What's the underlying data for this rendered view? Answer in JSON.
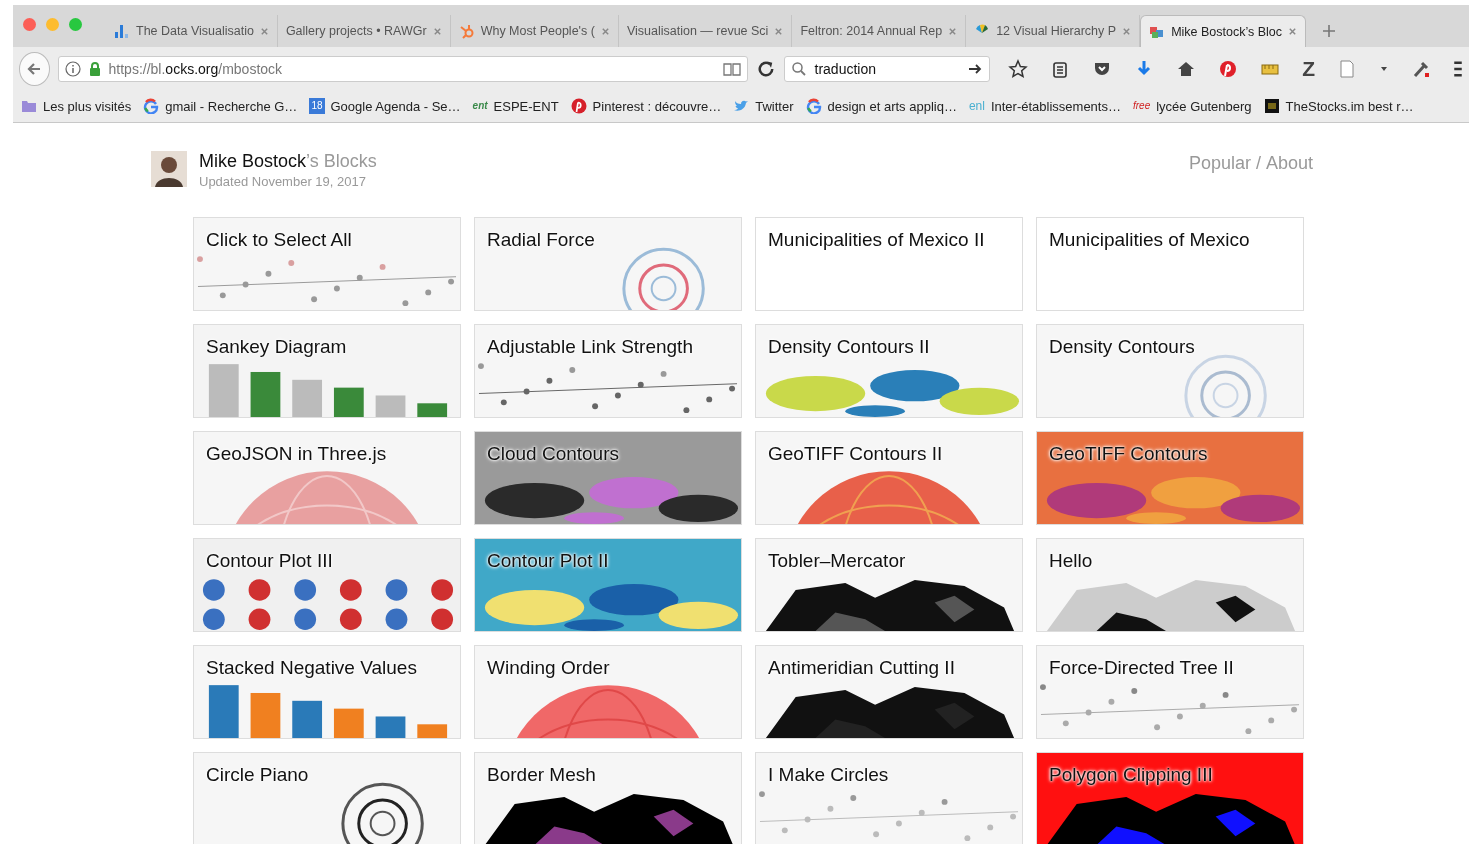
{
  "tabs": [
    {
      "title": "The Data Visualisatio",
      "kind": "bars",
      "selected": false
    },
    {
      "title": "Gallery projects • RAWGr",
      "kind": "none",
      "selected": false
    },
    {
      "title": "Why Most People's (",
      "kind": "hub",
      "selected": false
    },
    {
      "title": "Visualisation — revue Sci",
      "kind": "none",
      "selected": false
    },
    {
      "title": "Feltron: 2014 Annual Rep",
      "kind": "none",
      "selected": false
    },
    {
      "title": "12 Visual Hierarchy P",
      "kind": "fan",
      "selected": false
    },
    {
      "title": "Mike Bostock’s Bloc",
      "kind": "cubes",
      "selected": true
    }
  ],
  "url": {
    "scheme": "https://bl.",
    "domain": "ocks.org",
    "path": "/mbostock"
  },
  "search": {
    "value": "traduction"
  },
  "toolbar_text": "Z",
  "bookmarks": [
    {
      "label": "Les plus visités",
      "kind": "folder"
    },
    {
      "label": "gmail - Recherche G…",
      "kind": "google"
    },
    {
      "label": "Google Agenda - Se…",
      "kind": "calendar",
      "icon_text": "18"
    },
    {
      "label": "ESPE-ENT",
      "kind": "ent",
      "icon_text": "ent"
    },
    {
      "label": "Pinterest : découvre…",
      "kind": "pinterest"
    },
    {
      "label": "Twitter",
      "kind": "twitter"
    },
    {
      "label": "design et arts appliq…",
      "kind": "google"
    },
    {
      "label": "Inter-établissements…",
      "kind": "enl",
      "icon_text": "enl"
    },
    {
      "label": "lycée Gutenberg",
      "kind": "free",
      "icon_text": "free"
    },
    {
      "label": "TheStocks.im best r…",
      "kind": "stocks"
    }
  ],
  "header": {
    "owner": "Mike Bostock",
    "suffix": "’s Blocks",
    "updated": "Updated November 19, 2017",
    "nav": [
      "Popular",
      "/",
      "About"
    ]
  },
  "blocks": [
    {
      "title": "Click to Select All",
      "thumbnail": true
    },
    {
      "title": "Radial Force",
      "thumbnail": true
    },
    {
      "title": "Municipalities of Mexico II",
      "thumbnail": false
    },
    {
      "title": "Municipalities of Mexico",
      "thumbnail": false
    },
    {
      "title": "Sankey Diagram",
      "thumbnail": true
    },
    {
      "title": "Adjustable Link Strength",
      "thumbnail": true
    },
    {
      "title": "Density Contours II",
      "thumbnail": true
    },
    {
      "title": "Density Contours",
      "thumbnail": true
    },
    {
      "title": "GeoJSON in Three.js",
      "thumbnail": true
    },
    {
      "title": "Cloud Contours",
      "thumbnail": true
    },
    {
      "title": "GeoTIFF Contours II",
      "thumbnail": true
    },
    {
      "title": "GeoTIFF Contours",
      "thumbnail": true
    },
    {
      "title": "Contour Plot III",
      "thumbnail": true
    },
    {
      "title": "Contour Plot II",
      "thumbnail": true
    },
    {
      "title": "Tobler–Mercator",
      "thumbnail": true
    },
    {
      "title": "Hello",
      "thumbnail": true
    },
    {
      "title": "Stacked Negative Values",
      "thumbnail": true
    },
    {
      "title": "Winding Order",
      "thumbnail": true
    },
    {
      "title": "Antimeridian Cutting II",
      "thumbnail": true
    },
    {
      "title": "Force-Directed Tree II",
      "thumbnail": true
    },
    {
      "title": "Circle Piano",
      "thumbnail": true
    },
    {
      "title": "Border Mesh",
      "thumbnail": true
    },
    {
      "title": "I Make Circles",
      "thumbnail": true
    },
    {
      "title": "Polygon Clipping III",
      "thumbnail": true
    }
  ]
}
